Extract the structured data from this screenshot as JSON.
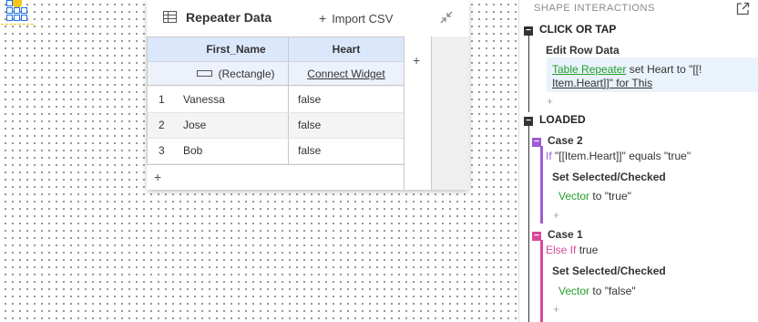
{
  "dialog": {
    "title": "Repeater Data",
    "import_label": "Import CSV",
    "columns": [
      "First_Name",
      "Heart"
    ],
    "bindings": [
      "(Rectangle)",
      "Connect Widget"
    ],
    "rows": [
      {
        "num": "1",
        "first_name": "Vanessa",
        "heart": "false"
      },
      {
        "num": "2",
        "first_name": "Jose",
        "heart": "false"
      },
      {
        "num": "3",
        "first_name": "Bob",
        "heart": "false"
      }
    ],
    "add_symbol": "+"
  },
  "panel": {
    "title": "SHAPE INTERACTIONS",
    "click_event": "CLICK OR TAP",
    "click_action_title": "Edit Row Data",
    "click_action_line1_target": "Table Repeater",
    "click_action_line1_rest": " set Heart to \"[[!",
    "click_action_line2": "Item.Heart]]\" for This",
    "loaded_event": "LOADED",
    "case2": {
      "title": "Case 2",
      "cond_kw": "If",
      "cond": " \"[[Item.Heart]]\" equals \"true\"",
      "action_title": "Set Selected/Checked",
      "target": "Vector",
      "rest": " to \"true\""
    },
    "case1": {
      "title": "Case 1",
      "cond_kw": "Else If",
      "cond": " true",
      "action_title": "Set Selected/Checked",
      "target": "Vector",
      "rest": " to \"false\""
    },
    "plus": "+",
    "minus": "−"
  },
  "colors": {
    "header_blue": "#dbe7fb",
    "accent_green": "#22a02a",
    "case2_purple": "#a05ad6",
    "case1_pink": "#d8489a"
  }
}
